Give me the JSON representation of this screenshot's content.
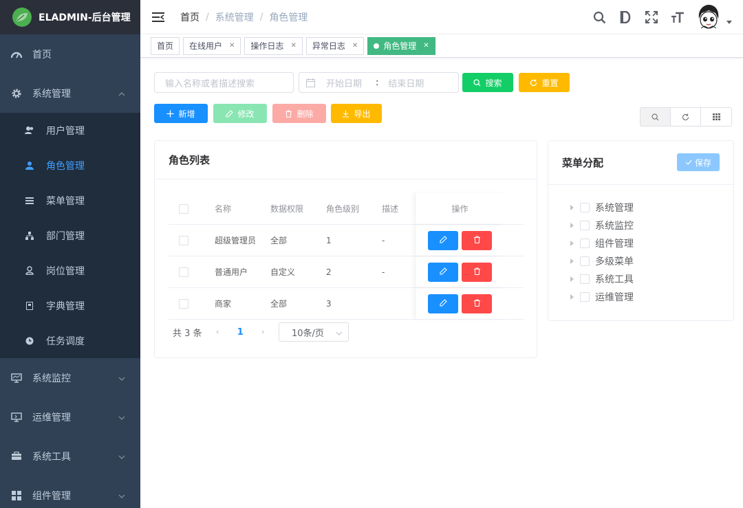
{
  "app": {
    "title": "ELADMIN-后台管理"
  },
  "sidebar": {
    "items": [
      {
        "label": "首页",
        "icon": "dashboard-icon"
      },
      {
        "label": "系统管理",
        "icon": "gear-icon",
        "expanded": true
      },
      {
        "label": "系统监控",
        "icon": "monitor-icon"
      },
      {
        "label": "运维管理",
        "icon": "devops-icon"
      },
      {
        "label": "系统工具",
        "icon": "toolbox-icon"
      },
      {
        "label": "组件管理",
        "icon": "components-icon"
      }
    ],
    "sub_items": [
      {
        "label": "用户管理",
        "icon": "users-icon"
      },
      {
        "label": "角色管理",
        "icon": "role-icon",
        "active": true
      },
      {
        "label": "菜单管理",
        "icon": "menu-list-icon"
      },
      {
        "label": "部门管理",
        "icon": "department-icon"
      },
      {
        "label": "岗位管理",
        "icon": "position-icon"
      },
      {
        "label": "字典管理",
        "icon": "dictionary-icon"
      },
      {
        "label": "任务调度",
        "icon": "clock-icon"
      }
    ]
  },
  "breadcrumb": [
    "首页",
    "系统管理",
    "角色管理"
  ],
  "tags": [
    {
      "label": "首页"
    },
    {
      "label": "在线用户"
    },
    {
      "label": "操作日志"
    },
    {
      "label": "异常日志"
    },
    {
      "label": "角色管理",
      "active": true
    }
  ],
  "search": {
    "placeholder": "输入名称或者描述搜索",
    "start_placeholder": "开始日期",
    "range_sep": ":",
    "end_placeholder": "结束日期",
    "search_label": "搜索",
    "reset_label": "重置"
  },
  "toolbar": {
    "add_label": "新增",
    "edit_label": "修改",
    "delete_label": "删除",
    "export_label": "导出"
  },
  "role_list": {
    "title": "角色列表",
    "columns": [
      "名称",
      "数据权限",
      "角色级别",
      "描述",
      "操作"
    ],
    "rows": [
      {
        "name": "超级管理员",
        "scope": "全部",
        "level": "1",
        "desc": "-"
      },
      {
        "name": "普通用户",
        "scope": "自定义",
        "level": "2",
        "desc": "-"
      },
      {
        "name": "商家",
        "scope": "全部",
        "level": "3",
        "desc": ""
      }
    ],
    "total_label": "共 3 条",
    "current_page": "1",
    "page_size": "10条/页"
  },
  "menu_assign": {
    "title": "菜单分配",
    "save_label": "保存",
    "nodes": [
      "系统管理",
      "系统监控",
      "组件管理",
      "多级菜单",
      "系统工具",
      "运维管理"
    ]
  },
  "colors": {
    "sidebar_bg": "#304156",
    "submenu_bg": "#1f2d3d",
    "active": "#409eff",
    "primary": "#1890ff",
    "success": "#13ce66",
    "warning": "#ffba00",
    "danger": "#ff4949",
    "tag_active": "#42b983"
  }
}
